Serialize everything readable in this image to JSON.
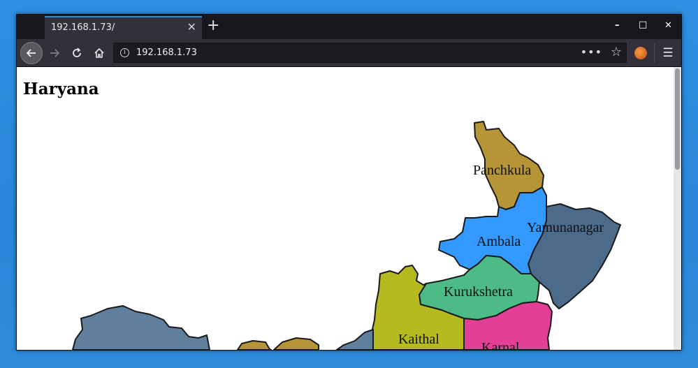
{
  "browser": {
    "tab_title": "192.168.1.73/",
    "tab_close": "✕",
    "new_tab": "+",
    "url": "192.168.1.73",
    "window_controls": {
      "minimize": "–",
      "maximize": "□",
      "close": "✕"
    },
    "icons": {
      "back": "back-arrow-icon",
      "forward": "forward-arrow-icon",
      "reload": "reload-icon",
      "home": "home-icon",
      "info": "info-icon",
      "page_actions": "more-dots-icon",
      "bookmark": "star-icon",
      "extension": "extension-icon",
      "menu": "hamburger-menu-icon"
    }
  },
  "page": {
    "heading": "Haryana"
  },
  "map": {
    "districts": [
      {
        "name": "Panchkula",
        "color": "#b59535"
      },
      {
        "name": "Yamunanagar",
        "color": "#4c6a8a"
      },
      {
        "name": "Ambala",
        "color": "#3399ff"
      },
      {
        "name": "Kurukshetra",
        "color": "#4dbb85"
      },
      {
        "name": "Kaithal",
        "color": "#b5bb1e"
      },
      {
        "name": "Karnal",
        "color": "#e33f97"
      }
    ]
  },
  "colors": {
    "accent": "#2f8fe0",
    "desktop": "#2f8fe0",
    "chrome_dark": "#1c1b22",
    "toolbar": "#323139"
  }
}
